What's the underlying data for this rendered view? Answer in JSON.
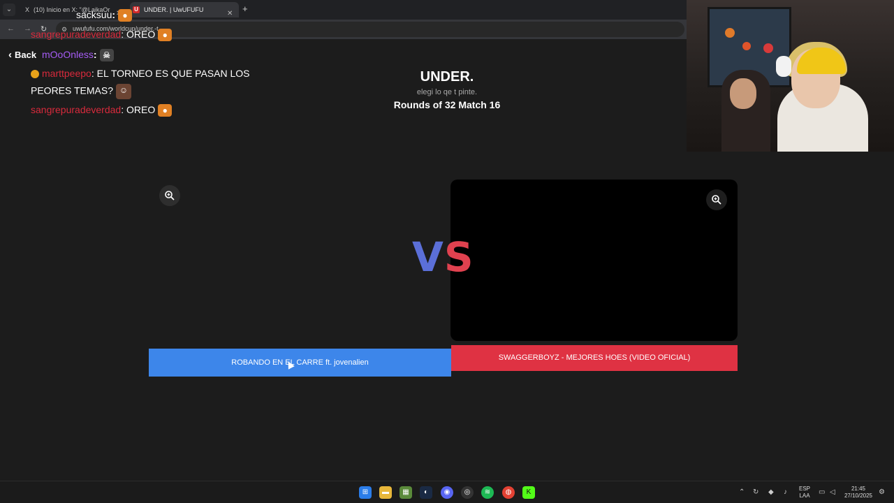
{
  "browser": {
    "tabs": [
      {
        "label": "(10) Inicio en X: \"@LaikaOr",
        "favicon": "X"
      },
      {
        "label": "UNDER. | UwUFUFU",
        "favicon": "U"
      }
    ],
    "url": "uwufufu.com/worldcup/under.-t..."
  },
  "page": {
    "back_label": "Back",
    "title": "UNDER.",
    "subtitle": "elegi lo qe t pinte.",
    "round": "Rounds of 32 Match 16",
    "vs_v": "V",
    "vs_s": "S",
    "left_choice": "ROBANDO EN EL CARRE ft. jovenalien",
    "right_choice": "SWAGGERBOYZ - MEJORES HOES (VIDEO OFICIAL)",
    "colors": {
      "left": "#3d86ea",
      "right": "#df3243",
      "vs_v": "#5b6fd8",
      "vs_s": "#e0414f"
    }
  },
  "chat": [
    {
      "user": "sangrepuradeverdad",
      "text": ": OREO",
      "emote": "cookie"
    },
    {
      "user": "sacksuu",
      "text": ":",
      "emote": "cookie"
    },
    {
      "user": "mOoOnless",
      "text": ":",
      "emote": "skull"
    },
    {
      "user": "marttpeepo",
      "text": ": EL TORNEO ES QUE PASAN LOS",
      "emote": ""
    },
    {
      "user": "",
      "text": "PEORES TEMAS?",
      "emote": "face"
    },
    {
      "user": "sangrepuradeverdad",
      "text": ": OREO",
      "emote": "cookie"
    }
  ],
  "taskbar": {
    "lang_top": "ESP",
    "lang_bottom": "LAA",
    "time": "21:45",
    "date": "27/10/2025"
  }
}
